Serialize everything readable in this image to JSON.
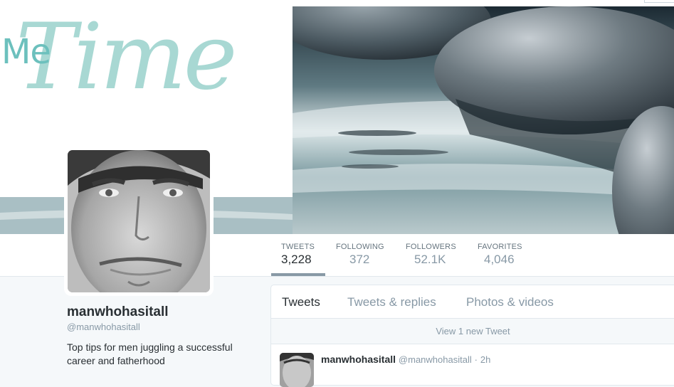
{
  "header": {
    "banner_text_me": "Me",
    "banner_text_time": "Time"
  },
  "stats": [
    {
      "label": "TWEETS",
      "value": "3,228",
      "active": true
    },
    {
      "label": "FOLLOWING",
      "value": "372",
      "active": false
    },
    {
      "label": "FOLLOWERS",
      "value": "52.1K",
      "active": false
    },
    {
      "label": "FAVORITES",
      "value": "4,046",
      "active": false
    }
  ],
  "profile": {
    "name": "manwhohasitall",
    "handle": "@manwhohasitall",
    "bio": "Top tips for men juggling a successful career and fatherhood"
  },
  "timeline": {
    "tabs": [
      {
        "label": "Tweets",
        "active": true
      },
      {
        "label": "Tweets & replies",
        "active": false
      },
      {
        "label": "Photos & videos",
        "active": false
      }
    ],
    "new_tweet_notice": "View 1 new Tweet",
    "tweet": {
      "name": "manwhohasitall",
      "handle": "@manwhohasitall",
      "dot": "·",
      "time": "2h"
    }
  },
  "colors": {
    "accent_gray": "#8899a6",
    "banner_teal": "#a8d8d3",
    "text_dark": "#292f33"
  },
  "icons": {
    "avatar": "profile-photo",
    "tweet_avatar": "profile-photo-small"
  }
}
